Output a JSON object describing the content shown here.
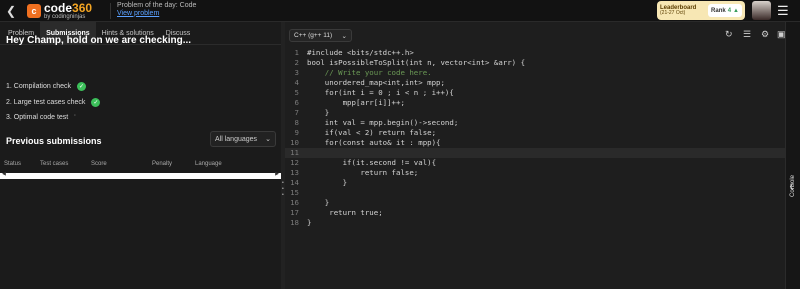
{
  "header": {
    "logo_badge": "c",
    "logo_word": "code",
    "logo_num": "360",
    "logo_sub": "by codingninjas",
    "potd_title": "Problem of the day: Code",
    "potd_link": "View problem",
    "leaderboard_title": "Leaderboard",
    "leaderboard_sub": "(21-27 Oct)",
    "rank_label": "Rank",
    "rank_value": "4",
    "accent": "#f07020"
  },
  "tabs": [
    {
      "label": "Problem"
    },
    {
      "label": "Submissions"
    },
    {
      "label": "Hints & solutions"
    },
    {
      "label": "Discuss"
    }
  ],
  "submission": {
    "heading": "Hey Champ, hold on we are checking...",
    "checks": [
      {
        "label": "1. Compilation check",
        "status": "passed"
      },
      {
        "label": "2. Large test cases check",
        "status": "passed"
      },
      {
        "label": "3. Optimal code test",
        "status": "running"
      }
    ],
    "previous_title": "Previous submissions",
    "language_filter": "All languages",
    "columns": [
      "Status",
      "Test cases",
      "Score",
      "Penalty",
      "Language"
    ]
  },
  "editor": {
    "language": "C++ (g++ 11)",
    "side_panel_label": "Console",
    "lines": [
      "#include <bits/stdc++.h>",
      "bool isPossibleToSplit(int n, vector<int> &arr) {",
      "    // Write your code here.",
      "    unordered_map<int,int> mpp;",
      "    for(int i = 0 ; i < n ; i++){",
      "        mpp[arr[i]]++;",
      "    }",
      "    int val = mpp.begin()->second;",
      "    if(val < 2) return false;",
      "    for(const auto& it : mpp){",
      "        ",
      "        if(it.second != val){",
      "            return false;",
      "        }",
      "",
      "    }",
      "     return true;",
      "}"
    ]
  }
}
